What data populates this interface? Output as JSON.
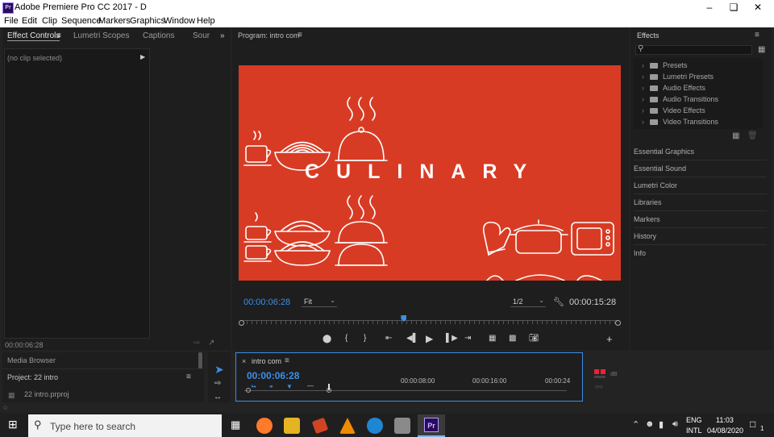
{
  "window": {
    "title": "Adobe Premiere Pro CC 2017 - D",
    "controls": [
      "minimize",
      "maximize",
      "close"
    ]
  },
  "menu": [
    "File",
    "Edit",
    "Clip",
    "Sequence",
    "Markers",
    "Graphics",
    "Window",
    "Help"
  ],
  "left_panel": {
    "tabs": [
      "Effect Controls",
      "Lumetri Scopes",
      "Captions",
      "Sour"
    ],
    "no_clip": "(no clip selected)",
    "timecode": "00:00:06:28"
  },
  "program": {
    "title": "Program: intro com",
    "video_text": "CULINARY",
    "timecode_current": "00:00:06:28",
    "fit": "Fit",
    "resolution": "1/2",
    "timecode_duration": "00:00:15:28",
    "playhead_fraction": 0.43
  },
  "effects": {
    "title": "Effects",
    "folders": [
      "Presets",
      "Lumetri Presets",
      "Audio Effects",
      "Audio Transitions",
      "Video Effects",
      "Video Transitions"
    ],
    "sections": [
      "Essential Graphics",
      "Essential Sound",
      "Lumetri Color",
      "Libraries",
      "Markers",
      "History",
      "Info"
    ]
  },
  "media": {
    "media_browser": "Media Browser",
    "project": "Project: 22 intro",
    "file": "22 intro.prproj"
  },
  "timeline": {
    "seq": "intro com",
    "timecode": "00:00:06:28",
    "marks": [
      "00:00:08:00",
      "00:00:16:00",
      "00:00:24"
    ]
  },
  "taskbar": {
    "search_placeholder": "Type here to search",
    "lang1": "ENG",
    "lang2": "INTL",
    "time": "11:03",
    "date": "04/08/2020",
    "notification_count": "1"
  },
  "colors": {
    "video_bg": "#d83b24",
    "accent_blue": "#3d8ee6",
    "panel": "#1e1e1e"
  }
}
